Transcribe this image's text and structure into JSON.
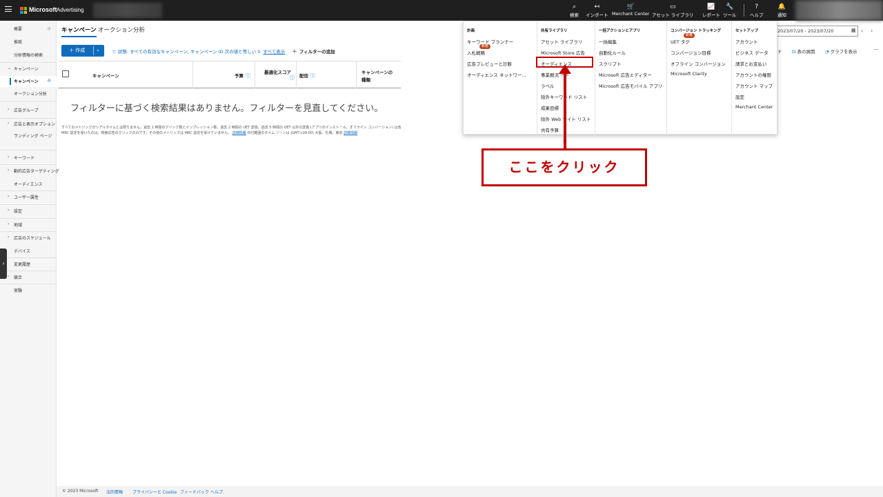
{
  "topbar": {
    "brand": "Microsoft",
    "brand_sub": "Advertising",
    "nav": [
      {
        "icon": "search-icon",
        "glyph": "⌕",
        "label": "検索"
      },
      {
        "icon": "import-icon",
        "glyph": "↤",
        "label": "インポート"
      },
      {
        "icon": "cart-icon",
        "glyph": "🛒",
        "label": "Merchant Center"
      },
      {
        "icon": "library-icon",
        "glyph": "▭",
        "label": "アセット ライブラリ"
      },
      {
        "icon": "report-icon",
        "glyph": "📈",
        "label": "レポート"
      },
      {
        "icon": "tools-icon",
        "glyph": "🔧",
        "label": "ツール"
      },
      {
        "icon": "help-icon",
        "glyph": "?",
        "label": "ヘルプ"
      },
      {
        "icon": "bell-icon",
        "glyph": "🔔",
        "label": "通知"
      }
    ]
  },
  "sidebar": {
    "items": [
      {
        "label": "概要"
      },
      {
        "label": "推奨"
      },
      {
        "label": "分析情報の検索"
      },
      {
        "label": "キャンペーン"
      },
      {
        "label": "キャンペーン"
      },
      {
        "label": "オークション分析"
      },
      {
        "label": "広告グループ"
      },
      {
        "label": "広告と表示オプション"
      },
      {
        "label": "ランディング ページ"
      },
      {
        "label": "キーワード"
      },
      {
        "label": "動的広告ターゲティング"
      },
      {
        "label": "オーディエンス"
      },
      {
        "label": "ユーザー属性"
      },
      {
        "label": "設定"
      },
      {
        "label": "地域"
      },
      {
        "label": "広告のスケジュール"
      },
      {
        "label": "デバイス"
      },
      {
        "label": "変更履歴"
      },
      {
        "label": "競合"
      },
      {
        "label": "実験"
      }
    ]
  },
  "main": {
    "tabs": [
      {
        "label": "キャンペーン"
      },
      {
        "label": "オークション分析"
      }
    ],
    "create_label": "＋ 作成",
    "filter": {
      "text": "状態: すべての有効なキャンペーン; キャンペーン ID 次の値と等しい 0",
      "show_all": "すべて表示",
      "add_filter": "フィルターの追加"
    },
    "columns": [
      {
        "label": "キャンペーン"
      },
      {
        "label": "予算"
      },
      {
        "label": "最適化スコア"
      },
      {
        "label": "配信"
      },
      {
        "label": "キャンペーンの"
      },
      {
        "label": "種類"
      }
    ],
    "empty_message": "フィルターに基づく検索結果はありません。フィルターを見直してください。",
    "notice_line1": "すべてのメトリックがリアルタイムとは限りません。過去 1 時間のクリック数とインプレッション数、過去 2 時間の UET 変換、過去 5 時間の UET 以外の変換 (アプリのインストール、オフライン コンバージョン) は含",
    "notice_line2": "MRC 認定を受けたのは、検索広告のクリックのみです。その他のメトリックは MRC 認定を受けていません。",
    "notice_link1": "詳細情報",
    "notice_mid": "日付範囲のタイム ゾーンは (GMT+09:00) 大阪、札幌、東京",
    "notice_link2": "詳細情報",
    "right_tools": {
      "keyword_partial": "ド",
      "table_view": "表の展開",
      "chart": "グラフを表示"
    },
    "date_range": "2023/07/20 - 2023/07/20"
  },
  "mega_menu": {
    "columns": [
      {
        "header": "計画",
        "items": [
          "キーワード プランナー",
          "入札戦略",
          "広告プレビューと診断",
          "オーディエンス ネットワー..."
        ]
      },
      {
        "header": "共有ライブラリ",
        "items": [
          "アセット ライブラリ",
          "Microsoft Store 広告",
          "オーディエンス",
          "事業概況 ード",
          "ラベル",
          "除外キーワード リスト",
          "成果目標",
          "除外 Web サイト リスト",
          "共有予算"
        ]
      },
      {
        "header": "一括アクションとアプリ",
        "items": [
          "一括編集",
          "自動化ルール",
          "スクリプト",
          "Microsoft 広告エディター",
          "Microsoft 広告モバイル アプリ"
        ]
      },
      {
        "header": "コンバージョン トラッキング",
        "items": [
          "UET タグ",
          "コンバージョン目標",
          "オフライン コンバージョン",
          "Microsoft Clarity"
        ]
      },
      {
        "header": "セットアップ",
        "items": [
          "アカウント",
          "ビジネス データ",
          "請求とお支払い",
          "アカウントの権限",
          "アカウント マップ",
          "設定",
          "Merchant Center"
        ]
      }
    ],
    "badge": "新着"
  },
  "annotation": {
    "callout": "ここをクリック",
    "color": "#c00000"
  },
  "footer": {
    "copyright": "© 2023 Microsoft",
    "links": [
      "法的情報",
      "プライバシーと Cookie",
      "フィードバック",
      "ヘルプ"
    ]
  }
}
